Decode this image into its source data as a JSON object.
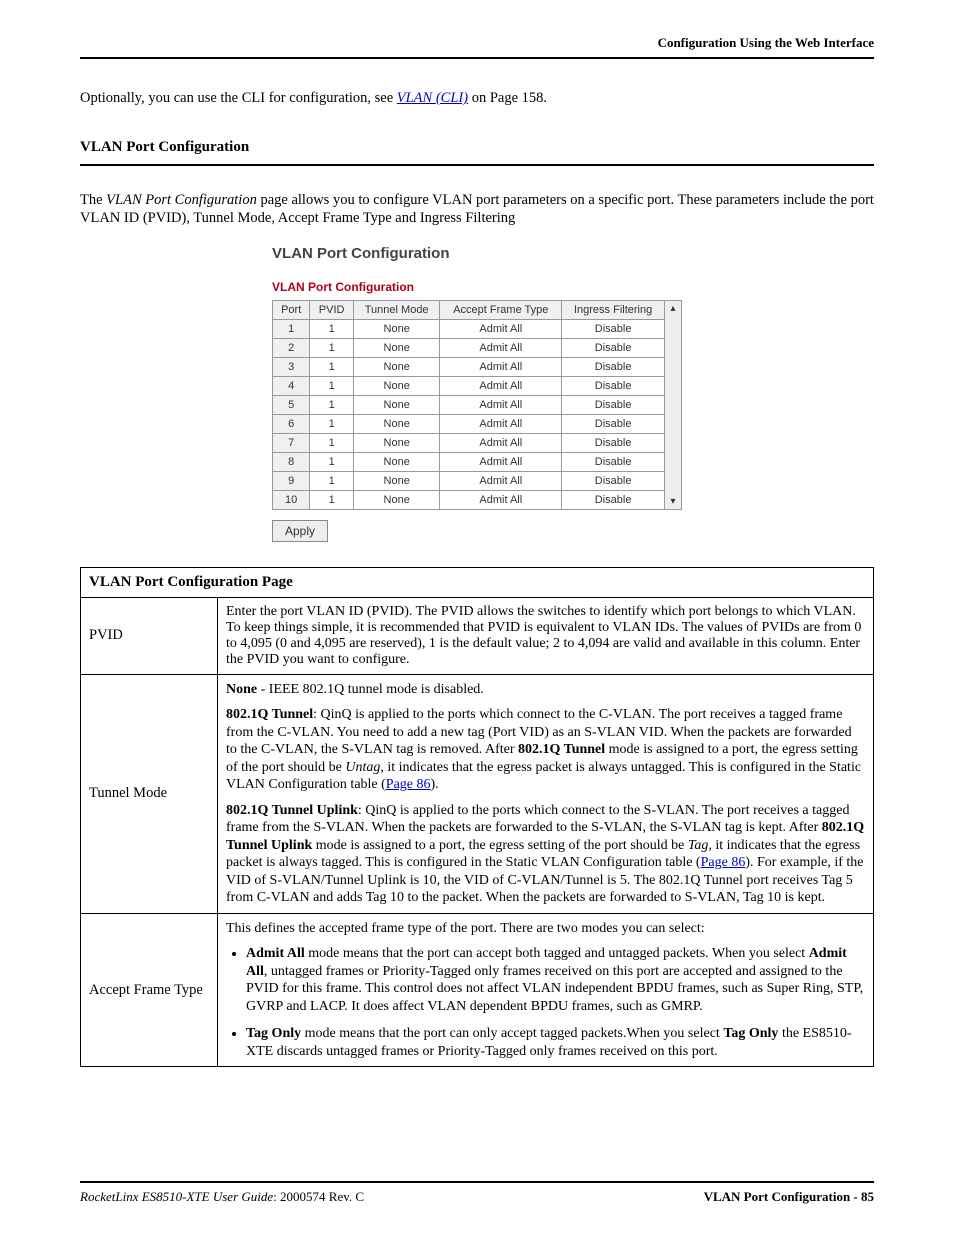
{
  "header": {
    "right": "Configuration Using the Web Interface"
  },
  "intro": {
    "prefix": "Optionally, you can use the CLI for configuration, see ",
    "link_text": "VLAN (CLI)",
    "suffix": " on Page 158."
  },
  "section": {
    "title": "VLAN Port Configuration",
    "body_prefix": "The ",
    "body_italic": "VLAN Port Configuration",
    "body_suffix": " page allows you to configure VLAN port parameters on a specific port. These parameters include the port VLAN ID (PVID), Tunnel Mode, Accept Frame Type and Ingress Filtering"
  },
  "screenshot": {
    "title": "VLAN Port Configuration",
    "subtitle": "VLAN Port Configuration",
    "headers": [
      "Port",
      "PVID",
      "Tunnel Mode",
      "Accept Frame Type",
      "Ingress Filtering"
    ],
    "rows": [
      {
        "port": "1",
        "pvid": "1",
        "tunnel": "None",
        "accept": "Admit All",
        "ingress": "Disable"
      },
      {
        "port": "2",
        "pvid": "1",
        "tunnel": "None",
        "accept": "Admit All",
        "ingress": "Disable"
      },
      {
        "port": "3",
        "pvid": "1",
        "tunnel": "None",
        "accept": "Admit All",
        "ingress": "Disable"
      },
      {
        "port": "4",
        "pvid": "1",
        "tunnel": "None",
        "accept": "Admit All",
        "ingress": "Disable"
      },
      {
        "port": "5",
        "pvid": "1",
        "tunnel": "None",
        "accept": "Admit All",
        "ingress": "Disable"
      },
      {
        "port": "6",
        "pvid": "1",
        "tunnel": "None",
        "accept": "Admit All",
        "ingress": "Disable"
      },
      {
        "port": "7",
        "pvid": "1",
        "tunnel": "None",
        "accept": "Admit All",
        "ingress": "Disable"
      },
      {
        "port": "8",
        "pvid": "1",
        "tunnel": "None",
        "accept": "Admit All",
        "ingress": "Disable"
      },
      {
        "port": "9",
        "pvid": "1",
        "tunnel": "None",
        "accept": "Admit All",
        "ingress": "Disable"
      },
      {
        "port": "10",
        "pvid": "1",
        "tunnel": "None",
        "accept": "Admit All",
        "ingress": "Disable"
      }
    ],
    "apply": "Apply"
  },
  "desc": {
    "header": "VLAN Port Configuration Page",
    "rows": {
      "pvid": {
        "label": "PVID",
        "text": "Enter the port VLAN ID (PVID). The PVID allows the switches to identify which port belongs to which VLAN. To keep things simple, it is recommended that PVID is equivalent to VLAN IDs. The values of PVIDs are from 0 to 4,095 (0 and 4,095 are reserved), 1 is the default value; 2 to 4,094 are valid and available in this column. Enter the PVID you want to configure."
      },
      "tunnel": {
        "label": "Tunnel Mode",
        "none_bold": "None",
        "none_rest": " - IEEE 802.1Q tunnel mode is disabled.",
        "p2_bold": "802.1Q Tunnel",
        "p2_a": ": QinQ is applied to the ports which connect to the C-VLAN. The port receives a tagged frame from the C-VLAN. You need to add a new tag (Port VID) as an S-VLAN VID. When the packets are forwarded to the C-VLAN, the S-VLAN tag is removed. After ",
        "p2_bold2": "802.1Q Tunnel",
        "p2_b": " mode is assigned to a port, the egress setting of the port should be ",
        "p2_italic": "Untag",
        "p2_c": ", it indicates that the egress packet is always untagged. This is configured in the Static VLAN Configuration table (",
        "p2_link": "Page 86",
        "p2_d": ").",
        "p3_bold": "802.1Q Tunnel Uplink",
        "p3_a": ": QinQ is applied to the ports which connect to the S-VLAN. The port receives a tagged frame from the S-VLAN. When the packets are forwarded to the S-VLAN, the S-VLAN tag is kept. After ",
        "p3_bold2": "802.1Q Tunnel Uplink",
        "p3_b": " mode is assigned to a port, the egress setting of the port should be ",
        "p3_italic": "Tag",
        "p3_c": ", it indicates that the egress packet is always tagged. This is configured in the Static VLAN Configuration table (",
        "p3_link": "Page 86",
        "p3_d": "). For example, if the VID of S-VLAN/Tunnel Uplink is 10, the VID of C-VLAN/Tunnel is 5. The 802.1Q Tunnel port receives Tag 5 from C-VLAN and adds Tag 10 to the packet. When the packets are forwarded to S-VLAN, Tag 10 is kept."
      },
      "accept": {
        "label": "Accept Frame Type",
        "intro": "This defines the accepted frame type of the port. There are two modes you can select:",
        "b1_bold1": "Admit All",
        "b1_a": " mode means that the port can accept both tagged and untagged packets. When you select ",
        "b1_bold2": "Admit All",
        "b1_b": ", untagged frames or Priority-Tagged only frames received on this port are accepted and assigned to the PVID for this frame. This control does not affect VLAN independent BPDU frames, such as Super Ring, STP, GVRP and LACP. It does affect VLAN dependent BPDU frames, such as GMRP.",
        "b2_bold1": "Tag Only",
        "b2_a": " mode means that the port can only accept tagged packets.When you select ",
        "b2_bold2": "Tag Only",
        "b2_b": " the ES8510-XTE discards untagged frames or Priority-Tagged only frames received on this port."
      }
    }
  },
  "footer": {
    "left_italic": "RocketLinx ES8510-XTE User Guide",
    "left_rest": ": 2000574 Rev. C",
    "right": "VLAN Port Configuration - 85"
  }
}
